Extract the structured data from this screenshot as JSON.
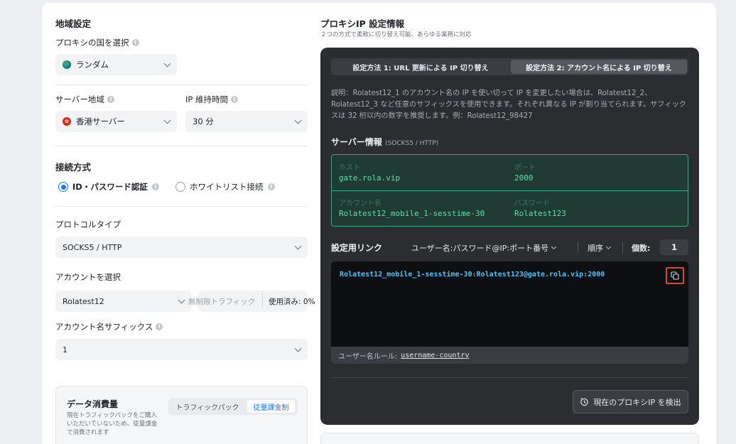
{
  "region": {
    "title": "地域設定",
    "country_label": "プロキシの国を選択",
    "country_value": "ランダム",
    "server_region_label": "サーバー地域",
    "server_region_value": "香港サーバー",
    "ip_hold_label": "IP 維持時間",
    "ip_hold_value": "30 分"
  },
  "connection": {
    "title": "接続方式",
    "option_id": "ID・パスワード認証",
    "option_whitelist": "ホワイトリスト接続",
    "selected": "ID・パスワード認証"
  },
  "protocol": {
    "label": "プロトコルタイプ",
    "value": "SOCKS5 / HTTP"
  },
  "account": {
    "label": "アカウントを選択",
    "value": "Rolatest12",
    "traffic": "無制限トラフィック",
    "used_label": "使用済み:",
    "used_value": "0%"
  },
  "suffix": {
    "label": "アカウント名サフィックス",
    "value": "1"
  },
  "data_usage": {
    "title": "データ消費量",
    "desc": "現在トラフィックパックをご購入いただいていないため、従量課金で消費されます",
    "tab_pack": "トラフィックパック",
    "tab_metered": "従量課金制",
    "active_tab": "従量課金制"
  },
  "proxy_info": {
    "title": "プロキシIP 設定情報",
    "subtitle": "２つの方式で柔軟に切り替え可能、あらゆる業務に対応",
    "tab1": "設定方法 1: URL 更新による IP 切り替え",
    "tab2": "設定方法 2: アカウント名による IP 切り替え",
    "active_tab": 2,
    "description": "説明：Rolatest12_1 のアカウント名の IP を使い切って IP を変更したい場合は、Rolatest12_2、Rolatest12_3 など任意のサフィックスを使用できます。それぞれ異なる IP が割り当てられます。サフィックスは 32 桁以内の数字を推奨します。例：Rolatest12_98427",
    "server_title": "サーバー情報",
    "server_title_note": "(SOCKS5 / HTTP)",
    "host_label": "ホスト",
    "host_value": "gate.rola.vip",
    "port_label": "ポート",
    "port_value": "2000",
    "account_label": "アカウント名",
    "account_value": "Rolatest12_mobile_1-sesstime-30",
    "password_label": "パスワード",
    "password_value": "Rolatest123",
    "link_title": "設定用リンク",
    "format_value": "ユーザー名:パスワード@IP:ポート番号",
    "order_label": "順序",
    "count_label": "個数:",
    "count_value": "1",
    "link": "Rolatest12_mobile_1-sesstime-30:Rolatest123@gate.rola.vip:2000",
    "rule_label": "ユーザー名ルール:",
    "rule_value": "username-country",
    "detect_button": "現在のプロキシIP を検出"
  },
  "colors": {
    "accent": "#1677ff",
    "dark_panel": "#2b2d31",
    "server_green": "#5ee0a8",
    "link_blue": "#4fc3f7",
    "copy_highlight": "#e0462a"
  }
}
